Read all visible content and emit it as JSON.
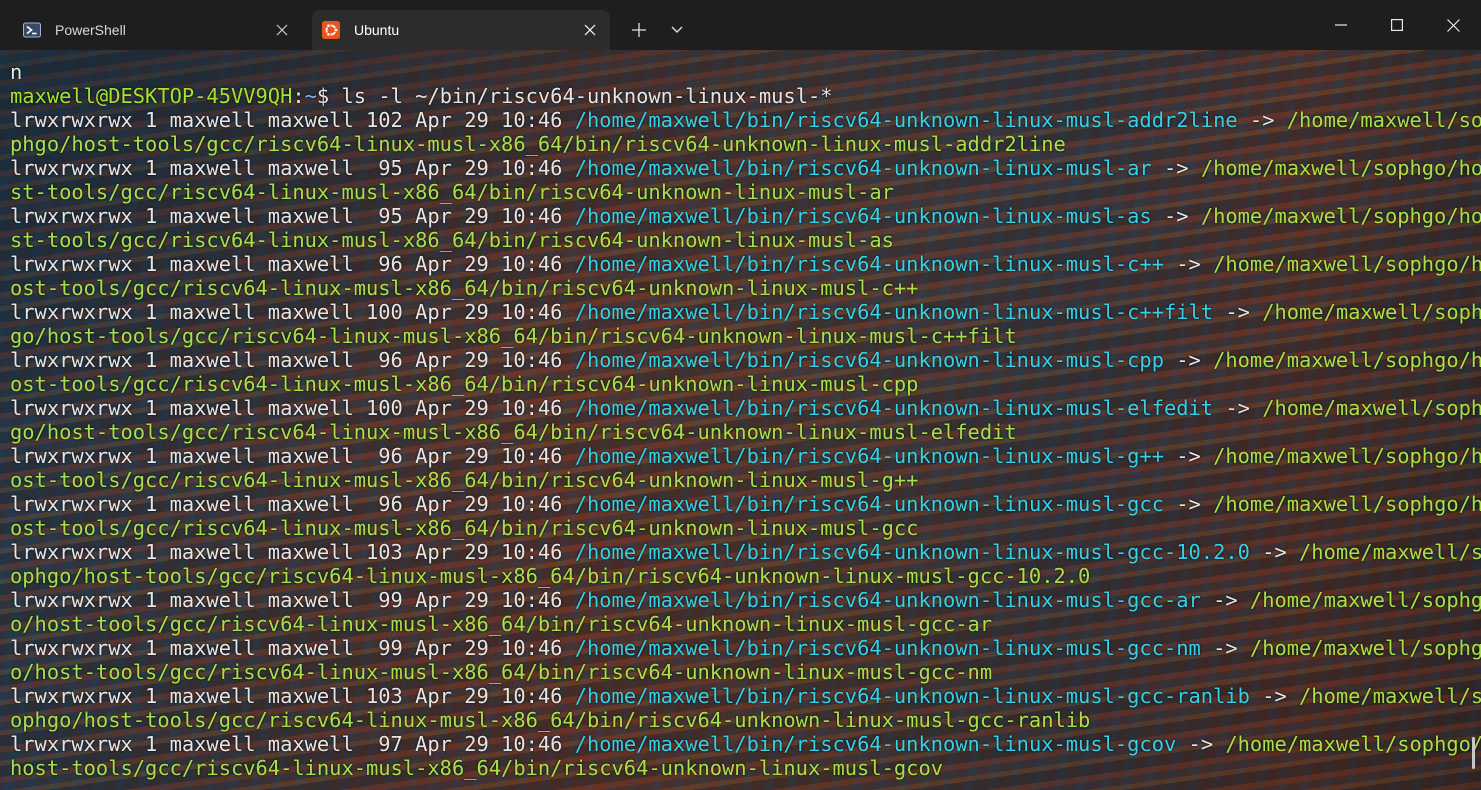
{
  "tabs": [
    {
      "label": "PowerShell",
      "icon": "powershell-icon",
      "active": false
    },
    {
      "label": "Ubuntu",
      "icon": "ubuntu-icon",
      "active": true
    }
  ],
  "colors": {
    "prompt_user": "#a6e22e",
    "prompt_path": "#7bb7ff",
    "link_source": "#36d1e8",
    "link_target": "#a8e04a",
    "ubuntu_orange": "#e95420"
  },
  "terminal": {
    "prev_line": "n",
    "prompt": {
      "user_host": "maxwell@DESKTOP-45VV9QH",
      "sep": ":",
      "path": "~",
      "symbol": "$ ",
      "command": "ls -l ~/bin/riscv64-unknown-linux-musl-*"
    },
    "lines": [
      [
        {
          "t": "lrwxrwxrwx 1 maxwell maxwell 102 Apr 29 10:46 ",
          "c": "plain"
        },
        {
          "t": "/home/maxwell/bin/riscv64-unknown-linux-musl-addr2line",
          "c": "cyan"
        },
        {
          "t": " -> ",
          "c": "plain"
        },
        {
          "t": "/home/maxwell/so",
          "c": "green"
        }
      ],
      [
        {
          "t": "phgo/host-tools/gcc/riscv64-linux-musl-x86_64/bin/riscv64-unknown-linux-musl-addr2line",
          "c": "green"
        }
      ],
      [
        {
          "t": "lrwxrwxrwx 1 maxwell maxwell  95 Apr 29 10:46 ",
          "c": "plain"
        },
        {
          "t": "/home/maxwell/bin/riscv64-unknown-linux-musl-ar",
          "c": "cyan"
        },
        {
          "t": " -> ",
          "c": "plain"
        },
        {
          "t": "/home/maxwell/sophgo/ho",
          "c": "green"
        }
      ],
      [
        {
          "t": "st-tools/gcc/riscv64-linux-musl-x86_64/bin/riscv64-unknown-linux-musl-ar",
          "c": "green"
        }
      ],
      [
        {
          "t": "lrwxrwxrwx 1 maxwell maxwell  95 Apr 29 10:46 ",
          "c": "plain"
        },
        {
          "t": "/home/maxwell/bin/riscv64-unknown-linux-musl-as",
          "c": "cyan"
        },
        {
          "t": " -> ",
          "c": "plain"
        },
        {
          "t": "/home/maxwell/sophgo/ho",
          "c": "green"
        }
      ],
      [
        {
          "t": "st-tools/gcc/riscv64-linux-musl-x86_64/bin/riscv64-unknown-linux-musl-as",
          "c": "green"
        }
      ],
      [
        {
          "t": "lrwxrwxrwx 1 maxwell maxwell  96 Apr 29 10:46 ",
          "c": "plain"
        },
        {
          "t": "/home/maxwell/bin/riscv64-unknown-linux-musl-c++",
          "c": "cyan"
        },
        {
          "t": " -> ",
          "c": "plain"
        },
        {
          "t": "/home/maxwell/sophgo/h",
          "c": "green"
        }
      ],
      [
        {
          "t": "ost-tools/gcc/riscv64-linux-musl-x86_64/bin/riscv64-unknown-linux-musl-c++",
          "c": "green"
        }
      ],
      [
        {
          "t": "lrwxrwxrwx 1 maxwell maxwell 100 Apr 29 10:46 ",
          "c": "plain"
        },
        {
          "t": "/home/maxwell/bin/riscv64-unknown-linux-musl-c++filt",
          "c": "cyan"
        },
        {
          "t": " -> ",
          "c": "plain"
        },
        {
          "t": "/home/maxwell/soph",
          "c": "green"
        }
      ],
      [
        {
          "t": "go/host-tools/gcc/riscv64-linux-musl-x86_64/bin/riscv64-unknown-linux-musl-c++filt",
          "c": "green"
        }
      ],
      [
        {
          "t": "lrwxrwxrwx 1 maxwell maxwell  96 Apr 29 10:46 ",
          "c": "plain"
        },
        {
          "t": "/home/maxwell/bin/riscv64-unknown-linux-musl-cpp",
          "c": "cyan"
        },
        {
          "t": " -> ",
          "c": "plain"
        },
        {
          "t": "/home/maxwell/sophgo/h",
          "c": "green"
        }
      ],
      [
        {
          "t": "ost-tools/gcc/riscv64-linux-musl-x86_64/bin/riscv64-unknown-linux-musl-cpp",
          "c": "green"
        }
      ],
      [
        {
          "t": "lrwxrwxrwx 1 maxwell maxwell 100 Apr 29 10:46 ",
          "c": "plain"
        },
        {
          "t": "/home/maxwell/bin/riscv64-unknown-linux-musl-elfedit",
          "c": "cyan"
        },
        {
          "t": " -> ",
          "c": "plain"
        },
        {
          "t": "/home/maxwell/soph",
          "c": "green"
        }
      ],
      [
        {
          "t": "go/host-tools/gcc/riscv64-linux-musl-x86_64/bin/riscv64-unknown-linux-musl-elfedit",
          "c": "green"
        }
      ],
      [
        {
          "t": "lrwxrwxrwx 1 maxwell maxwell  96 Apr 29 10:46 ",
          "c": "plain"
        },
        {
          "t": "/home/maxwell/bin/riscv64-unknown-linux-musl-g++",
          "c": "cyan"
        },
        {
          "t": " -> ",
          "c": "plain"
        },
        {
          "t": "/home/maxwell/sophgo/h",
          "c": "green"
        }
      ],
      [
        {
          "t": "ost-tools/gcc/riscv64-linux-musl-x86_64/bin/riscv64-unknown-linux-musl-g++",
          "c": "green"
        }
      ],
      [
        {
          "t": "lrwxrwxrwx 1 maxwell maxwell  96 Apr 29 10:46 ",
          "c": "plain"
        },
        {
          "t": "/home/maxwell/bin/riscv64-unknown-linux-musl-gcc",
          "c": "cyan"
        },
        {
          "t": " -> ",
          "c": "plain"
        },
        {
          "t": "/home/maxwell/sophgo/h",
          "c": "green"
        }
      ],
      [
        {
          "t": "ost-tools/gcc/riscv64-linux-musl-x86_64/bin/riscv64-unknown-linux-musl-gcc",
          "c": "green"
        }
      ],
      [
        {
          "t": "lrwxrwxrwx 1 maxwell maxwell 103 Apr 29 10:46 ",
          "c": "plain"
        },
        {
          "t": "/home/maxwell/bin/riscv64-unknown-linux-musl-gcc-10.2.0",
          "c": "cyan"
        },
        {
          "t": " -> ",
          "c": "plain"
        },
        {
          "t": "/home/maxwell/s",
          "c": "green"
        }
      ],
      [
        {
          "t": "ophgo/host-tools/gcc/riscv64-linux-musl-x86_64/bin/riscv64-unknown-linux-musl-gcc-10.2.0",
          "c": "green"
        }
      ],
      [
        {
          "t": "lrwxrwxrwx 1 maxwell maxwell  99 Apr 29 10:46 ",
          "c": "plain"
        },
        {
          "t": "/home/maxwell/bin/riscv64-unknown-linux-musl-gcc-ar",
          "c": "cyan"
        },
        {
          "t": " -> ",
          "c": "plain"
        },
        {
          "t": "/home/maxwell/sophg",
          "c": "green"
        }
      ],
      [
        {
          "t": "o/host-tools/gcc/riscv64-linux-musl-x86_64/bin/riscv64-unknown-linux-musl-gcc-ar",
          "c": "green"
        }
      ],
      [
        {
          "t": "lrwxrwxrwx 1 maxwell maxwell  99 Apr 29 10:46 ",
          "c": "plain"
        },
        {
          "t": "/home/maxwell/bin/riscv64-unknown-linux-musl-gcc-nm",
          "c": "cyan"
        },
        {
          "t": " -> ",
          "c": "plain"
        },
        {
          "t": "/home/maxwell/sophg",
          "c": "green"
        }
      ],
      [
        {
          "t": "o/host-tools/gcc/riscv64-linux-musl-x86_64/bin/riscv64-unknown-linux-musl-gcc-nm",
          "c": "green"
        }
      ],
      [
        {
          "t": "lrwxrwxrwx 1 maxwell maxwell 103 Apr 29 10:46 ",
          "c": "plain"
        },
        {
          "t": "/home/maxwell/bin/riscv64-unknown-linux-musl-gcc-ranlib",
          "c": "cyan"
        },
        {
          "t": " -> ",
          "c": "plain"
        },
        {
          "t": "/home/maxwell/s",
          "c": "green"
        }
      ],
      [
        {
          "t": "ophgo/host-tools/gcc/riscv64-linux-musl-x86_64/bin/riscv64-unknown-linux-musl-gcc-ranlib",
          "c": "green"
        }
      ],
      [
        {
          "t": "lrwxrwxrwx 1 maxwell maxwell  97 Apr 29 10:46 ",
          "c": "plain"
        },
        {
          "t": "/home/maxwell/bin/riscv64-unknown-linux-musl-gcov",
          "c": "cyan"
        },
        {
          "t": " -> ",
          "c": "plain"
        },
        {
          "t": "/home/maxwell/sophgo/",
          "c": "green"
        }
      ],
      [
        {
          "t": "host-tools/gcc/riscv64-linux-musl-x86_64/bin/riscv64-unknown-linux-musl-gcov",
          "c": "green"
        }
      ]
    ]
  }
}
